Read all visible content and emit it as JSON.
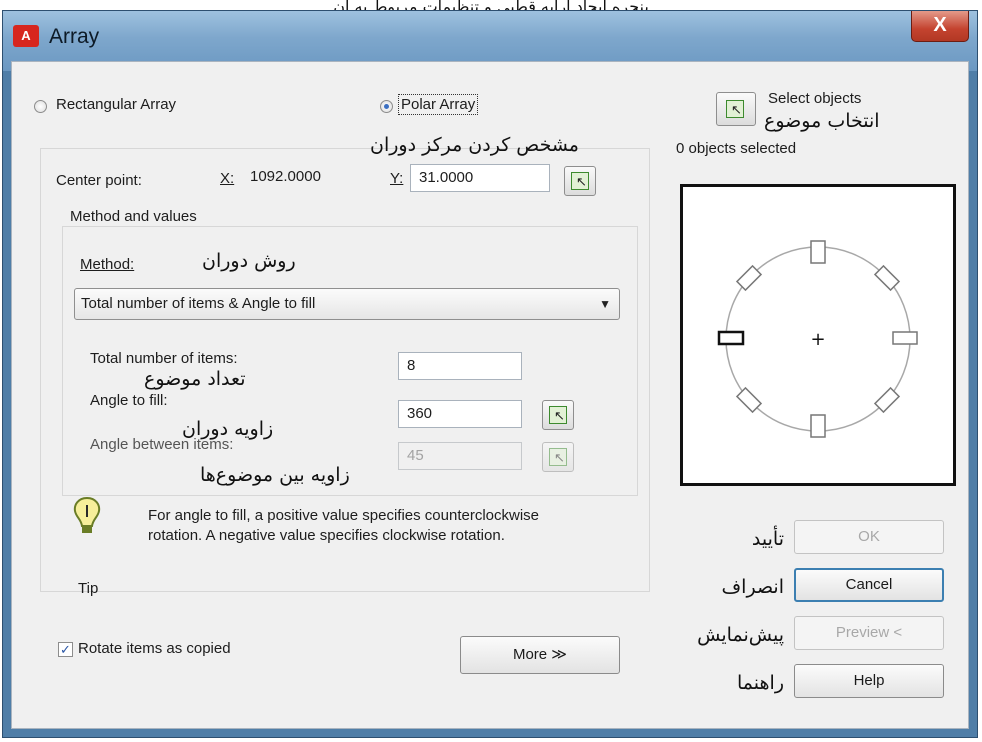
{
  "top_caption": "پنجره ایجاد آرایه قطبی و تنظیمات مربوط به آن",
  "window": {
    "title": "Array",
    "app_icon": "autocad-icon",
    "close_label": "X"
  },
  "array_type": {
    "rectangular_label": "Rectangular Array",
    "polar_label": "Polar Array",
    "selected": "polar"
  },
  "center_point": {
    "label": "Center point:",
    "x_label": "X:",
    "x_value": "1092.0000",
    "y_label": "Y:",
    "y_value": "31.0000"
  },
  "method_group": {
    "title": "Method and values",
    "method_label": "Method:",
    "method_value": "Total number of items & Angle to fill"
  },
  "fields": {
    "total_items_label": "Total number of items:",
    "total_items_value": "8",
    "angle_fill_label": "Angle to fill:",
    "angle_fill_value": "360",
    "angle_between_label": "Angle between items:",
    "angle_between_value": "45"
  },
  "tip": {
    "label": "Tip",
    "text": "For angle to fill, a positive value specifies counterclockwise rotation.  A negative value specifies clockwise rotation."
  },
  "rotate_items": {
    "label": "Rotate items as copied",
    "checked": true
  },
  "more_button": {
    "label": "More  ≫"
  },
  "select_objects": {
    "label": "Select objects",
    "status": "0 objects selected"
  },
  "buttons": {
    "ok": "OK",
    "cancel": "Cancel",
    "preview": "Preview <",
    "help": "Help"
  },
  "annotations": {
    "center": "مشخص کردن مرکز دوران",
    "select": "انتخاب موضوع",
    "method": "روش دوران",
    "count": "تعداد موضوع",
    "angle_fill": "زاویه دوران",
    "angle_between": "زاویه بین موضوع‌ها",
    "ok": "تأیید",
    "cancel": "انصراف",
    "preview": "پیش‌نمایش",
    "help": "راهنما"
  },
  "colors": {
    "window_frame": "#4f7ea8",
    "dialog_bg": "#f0f0f0",
    "close_button": "#c4432f"
  }
}
